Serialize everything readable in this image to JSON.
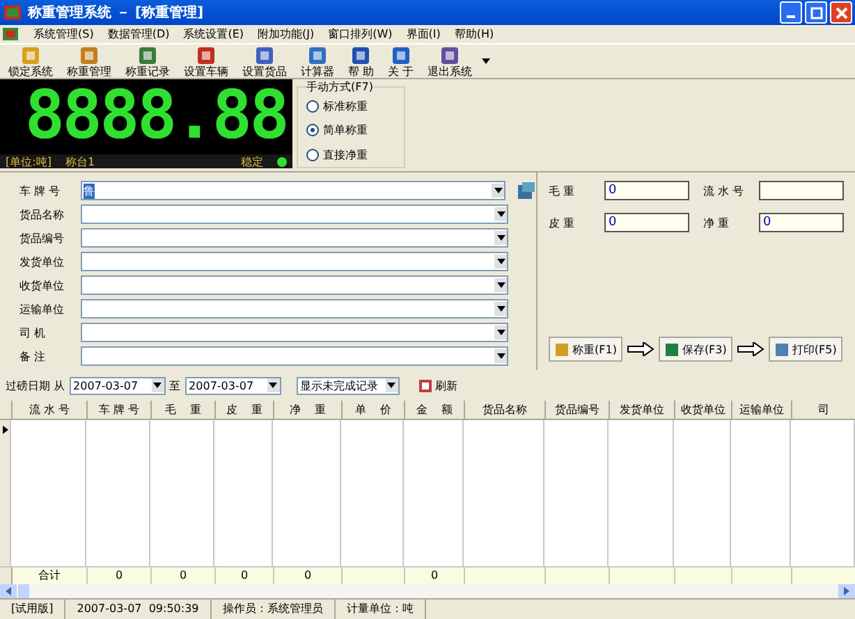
{
  "window": {
    "title": "称重管理系统 － [称重管理]"
  },
  "menu": [
    "系统管理(S)",
    "数据管理(D)",
    "系统设置(E)",
    "附加功能(J)",
    "窗口排列(W)",
    "界面(I)",
    "帮助(H)"
  ],
  "toolbar": [
    {
      "label": "锁定系统",
      "kind": "lock"
    },
    {
      "label": "称重管理",
      "kind": "scale"
    },
    {
      "label": "称重记录",
      "kind": "grid"
    },
    {
      "label": "设置车辆",
      "kind": "truck"
    },
    {
      "label": "设置货品",
      "kind": "goods"
    },
    {
      "label": "计算器",
      "kind": "calc"
    },
    {
      "label": "帮 助",
      "kind": "help"
    },
    {
      "label": "关 于",
      "kind": "info"
    },
    {
      "label": "退出系统",
      "kind": "exit"
    }
  ],
  "display": {
    "reading": "8888.88",
    "unit": "[单位:吨]",
    "platform": "称台1",
    "status": "稳定",
    "stable": true
  },
  "mode": {
    "title": "手动方式(F7)",
    "options": [
      {
        "label": "标准称重",
        "selected": false
      },
      {
        "label": "简单称重",
        "selected": true
      },
      {
        "label": "直接净重",
        "selected": false
      }
    ]
  },
  "form": [
    {
      "label": "车 牌 号",
      "value": "鲁"
    },
    {
      "label": "货品名称"
    },
    {
      "label": "货品编号"
    },
    {
      "label": "发货单位"
    },
    {
      "label": "收货单位"
    },
    {
      "label": "运输单位"
    },
    {
      "label": "司    机"
    },
    {
      "label": "备    注"
    }
  ],
  "weights": [
    {
      "label": "毛    重",
      "value": "0"
    },
    {
      "label": "流 水 号"
    },
    {
      "label": "皮    重",
      "value": "0"
    },
    {
      "label": "净    重",
      "value": "0"
    }
  ],
  "actions": [
    {
      "label": "称重(F1)",
      "kind": "weigh"
    },
    {
      "label": "保存(F3)",
      "kind": "save"
    },
    {
      "label": "打印(F5)",
      "kind": "print"
    }
  ],
  "filter": {
    "label": "过磅日期 从",
    "from": "2007-03-07",
    "to_label": "至",
    "to": "2007-03-07",
    "show": "显示未完成记录",
    "refresh": "刷新"
  },
  "table": {
    "columns": [
      {
        "name": "流 水 号",
        "total": "合计"
      },
      {
        "name": "车 牌 号",
        "total": "0"
      },
      {
        "name": "毛    重",
        "total": "0"
      },
      {
        "name": "皮    重",
        "total": "0"
      },
      {
        "name": "净    重",
        "total": "0"
      },
      {
        "name": "单    价"
      },
      {
        "name": "金    额",
        "total": "0"
      },
      {
        "name": "货品名称"
      },
      {
        "name": "货品编号"
      },
      {
        "name": "发货单位"
      },
      {
        "name": "收货单位"
      },
      {
        "name": "运输单位"
      },
      {
        "name": "司"
      }
    ]
  },
  "status_bar": [
    "[试用版]",
    "2007-03-07  09:50:39",
    "操作员：系统管理员",
    "计量单位：吨"
  ]
}
